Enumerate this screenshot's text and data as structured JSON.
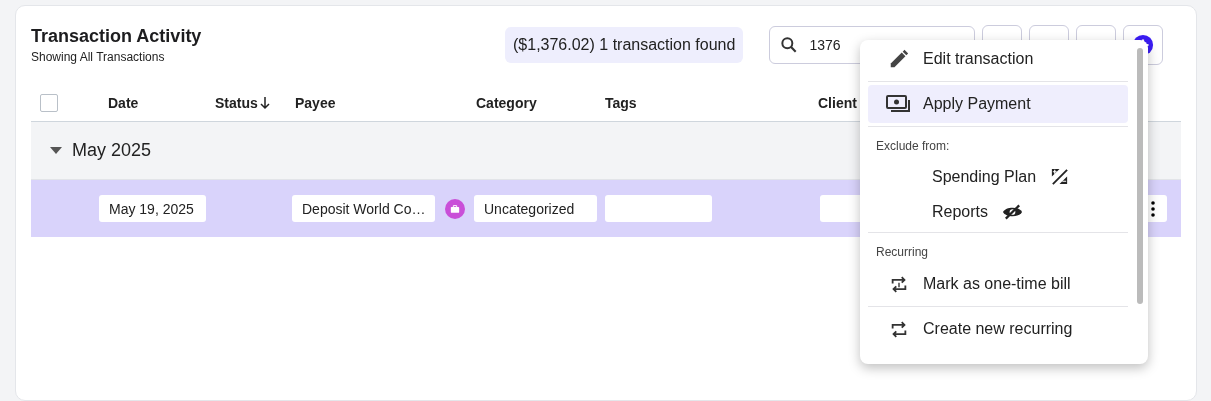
{
  "header": {
    "title": "Transaction Activity",
    "subtitle": "Showing All Transactions",
    "summary": "($1,376.02) 1 transaction found"
  },
  "search": {
    "value": "1376"
  },
  "select_all": {
    "checked": false
  },
  "columns": [
    {
      "label": "Date",
      "sorted": false
    },
    {
      "label": "Status",
      "sorted": true
    },
    {
      "label": "Payee",
      "sorted": false
    },
    {
      "label": "Category",
      "sorted": false
    },
    {
      "label": "Tags",
      "sorted": false
    },
    {
      "label": "Client",
      "sorted": false
    }
  ],
  "groups": [
    {
      "label": "May 2025",
      "expanded": true,
      "rows": [
        {
          "date": "May 19, 2025",
          "payee": "Deposit World Co…",
          "category": "Uncategorized",
          "selected": true
        }
      ]
    }
  ],
  "menu": {
    "items": [
      {
        "kind": "action",
        "label": "Edit transaction",
        "selected": false
      },
      {
        "kind": "action",
        "label": "Apply Payment",
        "selected": true
      },
      {
        "kind": "section",
        "label": "Exclude from:"
      },
      {
        "kind": "toggle",
        "label": "Spending Plan"
      },
      {
        "kind": "toggle",
        "label": "Reports"
      },
      {
        "kind": "section",
        "label": "Recurring"
      },
      {
        "kind": "action",
        "label": "Mark as one-time bill",
        "selected": false
      },
      {
        "kind": "action",
        "label": "Create new recurring",
        "selected": false
      }
    ]
  }
}
